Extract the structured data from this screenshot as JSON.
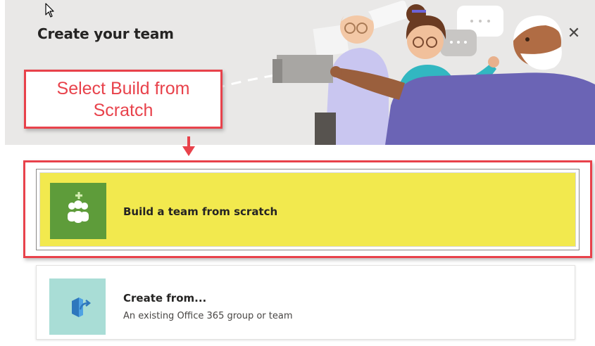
{
  "dialog": {
    "title": "Create your team",
    "close_icon": "close-icon"
  },
  "annotation": {
    "callout_text_line1": "Select Build from",
    "callout_text_line2": "Scratch",
    "callout_color": "#e8424b"
  },
  "options": [
    {
      "label": "Build a team from scratch",
      "icon": "people-add-icon",
      "tile_color": "#5e9c3a",
      "highlight_color": "#f2e94e"
    },
    {
      "label": "Create from...",
      "description": "An existing Office 365 group or team",
      "icon": "arrow-out-of-box-icon",
      "tile_color": "#a9ddd6"
    }
  ]
}
